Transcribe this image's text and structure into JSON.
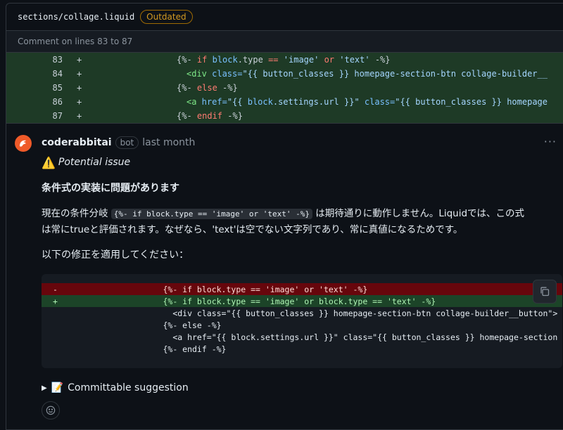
{
  "file": {
    "path": "sections/collage.liquid",
    "badge": "Outdated"
  },
  "comment_on": "Comment on lines 83 to 87",
  "diff": {
    "lines": [
      {
        "num": "83",
        "sign": "+"
      },
      {
        "num": "84",
        "sign": "+"
      },
      {
        "num": "85",
        "sign": "+"
      },
      {
        "num": "86",
        "sign": "+"
      },
      {
        "num": "87",
        "sign": "+"
      }
    ],
    "l83": {
      "open": "{%- ",
      "kw_if": "if",
      "sp1": " ",
      "block": "block",
      "dot": ".",
      "type": "type",
      "eq": " == ",
      "s1": "'image'",
      "or": " or ",
      "s2": "'text'",
      "close": " -%}"
    },
    "l84": {
      "tag": "<div",
      "attr": " class=",
      "val": "\"{{ button_classes }} homepage-section-btn collage-builder__"
    },
    "l85": {
      "open": "{%- ",
      "kw": "else",
      "close": " -%}"
    },
    "l86": {
      "tag": "<a",
      "attr": " href=",
      "val1": "\"{{ ",
      "block": "block",
      "rest": ".settings.url }}\"",
      "attr2": " class=",
      "val2": "\"{{ button_classes }} homepage"
    },
    "l87": {
      "open": "{%- ",
      "kw": "endif",
      "close": " -%}"
    }
  },
  "comment": {
    "author": "coderabbitai",
    "bot_label": "bot",
    "when": "last month",
    "more": "···",
    "potential_issue": "Potential issue",
    "heading": "条件式の実装に問題があります",
    "para1_a": "現在の条件分岐",
    "para1_code": "{%- if block.type == 'image' or 'text' -%}",
    "para1_b": "は期待通りに動作しません。Liquidでは、この式",
    "para1_c": "は常にtrueと評価されます。なぜなら、'text'は空でない文字列であり、常に真値になるためです。",
    "para2": "以下の修正を適用してください：",
    "suggestion": {
      "lines": [
        {
          "sign": "-",
          "text": "                    {%- if block.type == 'image' or 'text' -%}"
        },
        {
          "sign": "+",
          "text": "                    {%- if block.type == 'image' or block.type == 'text' -%}"
        },
        {
          "sign": "",
          "text": "                      <div class=\"{{ button_classes }} homepage-section-btn collage-builder__button\">"
        },
        {
          "sign": "",
          "text": "                    {%- else -%}"
        },
        {
          "sign": "",
          "text": "                      <a href=\"{{ block.settings.url }}\" class=\"{{ button_classes }} homepage-section"
        },
        {
          "sign": "",
          "text": "                    {%- endif -%}"
        }
      ]
    },
    "committable": "Committable suggestion"
  },
  "icons": {
    "warning": "warning-icon",
    "copy": "copy-icon",
    "memo": "memo-icon",
    "smiley": "smiley-icon",
    "avatar": "coderabbit-avatar"
  }
}
